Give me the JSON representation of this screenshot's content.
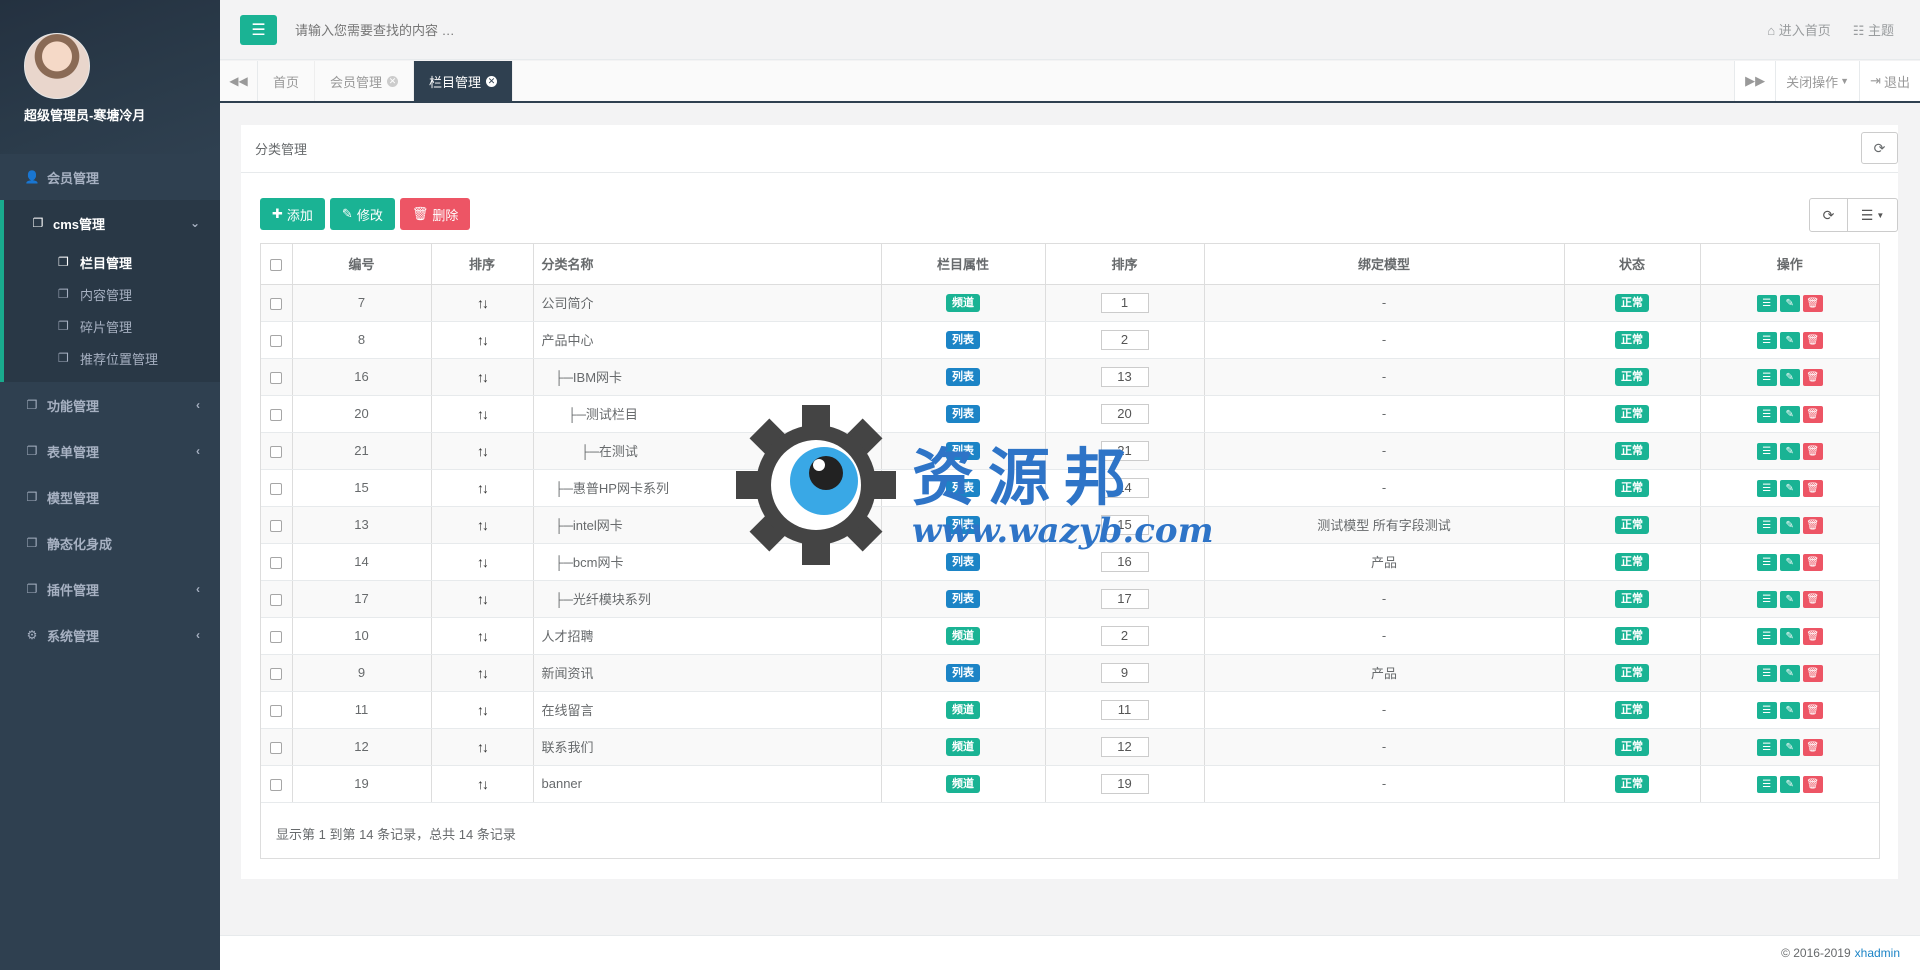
{
  "sidebar": {
    "profile_name": "超级管理员-寒塘冷月",
    "items": [
      {
        "label": "会员管理",
        "icon": "user-icon",
        "arrow": ""
      },
      {
        "label": "cms管理",
        "icon": "copy-icon",
        "arrow": "chevron-down-icon"
      },
      {
        "label": "功能管理",
        "icon": "copy-icon",
        "arrow": "chevron-left-icon"
      },
      {
        "label": "表单管理",
        "icon": "copy-icon",
        "arrow": "chevron-left-icon"
      },
      {
        "label": "模型管理",
        "icon": "copy-icon",
        "arrow": ""
      },
      {
        "label": "静态化身成",
        "icon": "copy-icon",
        "arrow": ""
      },
      {
        "label": "插件管理",
        "icon": "copy-icon",
        "arrow": "chevron-left-icon"
      },
      {
        "label": "系统管理",
        "icon": "cogs-icon",
        "arrow": "chevron-left-icon"
      }
    ],
    "cms_sub": [
      {
        "label": "栏目管理",
        "active": true
      },
      {
        "label": "内容管理",
        "active": false
      },
      {
        "label": "碎片管理",
        "active": false
      },
      {
        "label": "推荐位置管理",
        "active": false
      }
    ]
  },
  "topbar": {
    "search_placeholder": "请输入您需要查找的内容 …",
    "home_link": "进入首页",
    "theme_link": "主题"
  },
  "tabs": {
    "items": [
      {
        "label": "首页",
        "closable": false,
        "active": false
      },
      {
        "label": "会员管理",
        "closable": true,
        "active": false
      },
      {
        "label": "栏目管理",
        "closable": true,
        "active": true
      }
    ],
    "close_ops": "关闭操作",
    "logout": "退出"
  },
  "panel": {
    "title": "分类管理",
    "buttons": {
      "add": "添加",
      "edit": "修改",
      "delete": "删除"
    },
    "columns": [
      "编号",
      "排序",
      "分类名称",
      "栏目属性",
      "排序",
      "绑定模型",
      "状态",
      "操作"
    ],
    "rows": [
      {
        "id": "7",
        "name": "公司简介",
        "attr": "频道",
        "attr_type": "channel",
        "sort": "1",
        "model": "-",
        "status": "正常"
      },
      {
        "id": "8",
        "name": "产品中心",
        "attr": "列表",
        "attr_type": "list",
        "sort": "2",
        "model": "-",
        "status": "正常"
      },
      {
        "id": "16",
        "name": "├─IBM网卡",
        "indent": 1,
        "attr": "列表",
        "attr_type": "list",
        "sort": "13",
        "model": "-",
        "status": "正常"
      },
      {
        "id": "20",
        "name": "├─测试栏目",
        "indent": 2,
        "attr": "列表",
        "attr_type": "list",
        "sort": "20",
        "model": "-",
        "status": "正常"
      },
      {
        "id": "21",
        "name": "├─在测试",
        "indent": 3,
        "attr": "列表",
        "attr_type": "list",
        "sort": "21",
        "model": "-",
        "status": "正常"
      },
      {
        "id": "15",
        "name": "├─惠普HP网卡系列",
        "indent": 1,
        "attr": "列表",
        "attr_type": "list",
        "sort": "14",
        "model": "-",
        "status": "正常"
      },
      {
        "id": "13",
        "name": "├─intel网卡",
        "indent": 1,
        "attr": "列表",
        "attr_type": "list",
        "sort": "15",
        "model": "测试模型 所有字段测试",
        "status": "正常"
      },
      {
        "id": "14",
        "name": "├─bcm网卡",
        "indent": 1,
        "attr": "列表",
        "attr_type": "list",
        "sort": "16",
        "model": "产品",
        "status": "正常"
      },
      {
        "id": "17",
        "name": "├─光纤模块系列",
        "indent": 1,
        "attr": "列表",
        "attr_type": "list",
        "sort": "17",
        "model": "-",
        "status": "正常"
      },
      {
        "id": "10",
        "name": "人才招聘",
        "attr": "频道",
        "attr_type": "channel",
        "sort": "2",
        "model": "-",
        "status": "正常"
      },
      {
        "id": "9",
        "name": "新闻资讯",
        "attr": "列表",
        "attr_type": "list",
        "sort": "9",
        "model": "产品",
        "status": "正常"
      },
      {
        "id": "11",
        "name": "在线留言",
        "attr": "频道",
        "attr_type": "channel",
        "sort": "11",
        "model": "-",
        "status": "正常"
      },
      {
        "id": "12",
        "name": "联系我们",
        "attr": "频道",
        "attr_type": "channel",
        "sort": "12",
        "model": "-",
        "status": "正常"
      },
      {
        "id": "19",
        "name": "banner",
        "attr": "频道",
        "attr_type": "channel",
        "sort": "19",
        "model": "-",
        "status": "正常"
      }
    ],
    "footer_text": "显示第 1 到第 14 条记录，总共 14 条记录"
  },
  "watermark": {
    "title": "资源邦",
    "url": "www.wazyb.com"
  },
  "footer": {
    "copyright": "© 2016-2019",
    "brand": "xhadmin"
  },
  "colors": {
    "primary": "#1ab394",
    "danger": "#ed5565",
    "info": "#1c84c6",
    "sidebar": "#2f4050"
  }
}
